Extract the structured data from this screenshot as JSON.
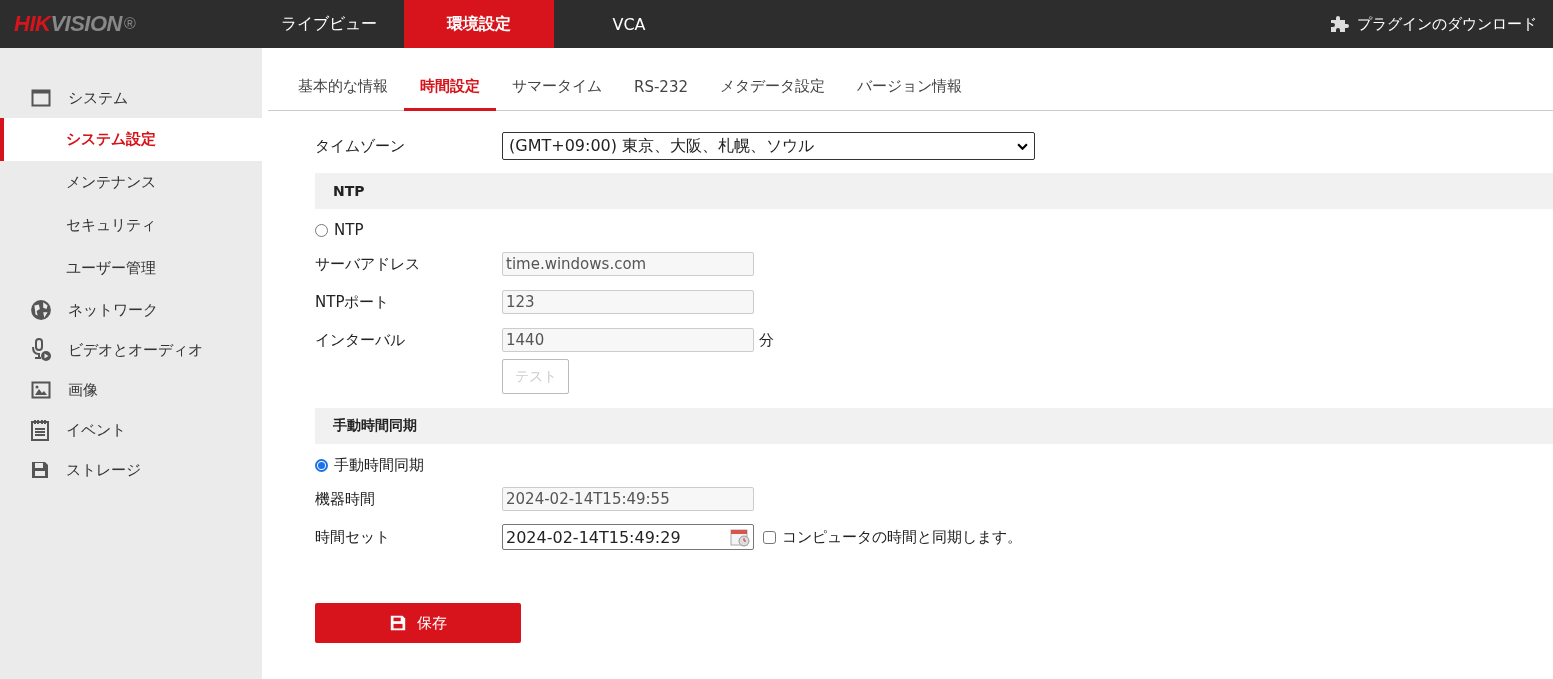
{
  "header": {
    "logo": {
      "primary": "HIK",
      "secondary": "VISION",
      "mark": "®"
    },
    "nav": [
      {
        "label": "ライブビュー",
        "selected": false
      },
      {
        "label": "環境設定",
        "selected": true
      },
      {
        "label": "VCA",
        "selected": false
      }
    ],
    "plugin_link": "プラグインのダウンロード"
  },
  "sidebar": {
    "items": [
      {
        "label": "システム",
        "children": [
          {
            "label": "システム設定",
            "selected": true
          },
          {
            "label": "メンテナンス",
            "selected": false
          },
          {
            "label": "セキュリティ",
            "selected": false
          },
          {
            "label": "ユーザー管理",
            "selected": false
          }
        ]
      },
      {
        "label": "ネットワーク"
      },
      {
        "label": "ビデオとオーディオ"
      },
      {
        "label": "画像"
      },
      {
        "label": "イベント"
      },
      {
        "label": "ストレージ"
      }
    ]
  },
  "tabs": [
    {
      "label": "基本的な情報",
      "selected": false
    },
    {
      "label": "時間設定",
      "selected": true
    },
    {
      "label": "サマータイム",
      "selected": false
    },
    {
      "label": "RS-232",
      "selected": false
    },
    {
      "label": "メタデータ設定",
      "selected": false
    },
    {
      "label": "バージョン情報",
      "selected": false
    }
  ],
  "timezone": {
    "label": "タイムゾーン",
    "value": "(GMT+09:00) 東京、大阪、札幌、ソウル"
  },
  "ntp": {
    "title": "NTP",
    "radio": {
      "label": "NTP",
      "selected": false
    },
    "fields": [
      {
        "label": "サーバアドレス",
        "value": "time.windows.com",
        "disabled": true
      },
      {
        "label": "NTPポート",
        "value": "123",
        "disabled": true
      },
      {
        "label": "インターバル",
        "value": "1440",
        "disabled": true,
        "unit": "分"
      }
    ],
    "test_button": {
      "label": "テスト",
      "disabled": true
    }
  },
  "manual": {
    "title": "手動時間同期",
    "radio": {
      "label": "手動時間同期",
      "selected": true
    },
    "device_time": {
      "label": "機器時間",
      "value": "2024-02-14T15:49:55",
      "disabled": true
    },
    "set_time": {
      "label": "時間セット",
      "value": "2024-02-14T15:49:29",
      "disabled": false
    },
    "sync_checkbox": {
      "label": "コンピュータの時間と同期します。",
      "checked": false
    }
  },
  "save_button": {
    "label": "保存"
  }
}
